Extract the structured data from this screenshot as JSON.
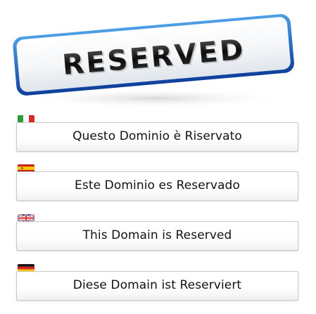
{
  "banner": {
    "text": "RESERVED",
    "border_color": "#1e57b8"
  },
  "notices": [
    {
      "flag": "italy-flag-icon",
      "text": "Questo Dominio è Riservato"
    },
    {
      "flag": "spain-flag-icon",
      "text": "Este Dominio es Reservado"
    },
    {
      "flag": "uk-flag-icon",
      "text": "This Domain is Reserved"
    },
    {
      "flag": "germany-flag-icon",
      "text": "Diese Domain ist Reserviert"
    }
  ]
}
